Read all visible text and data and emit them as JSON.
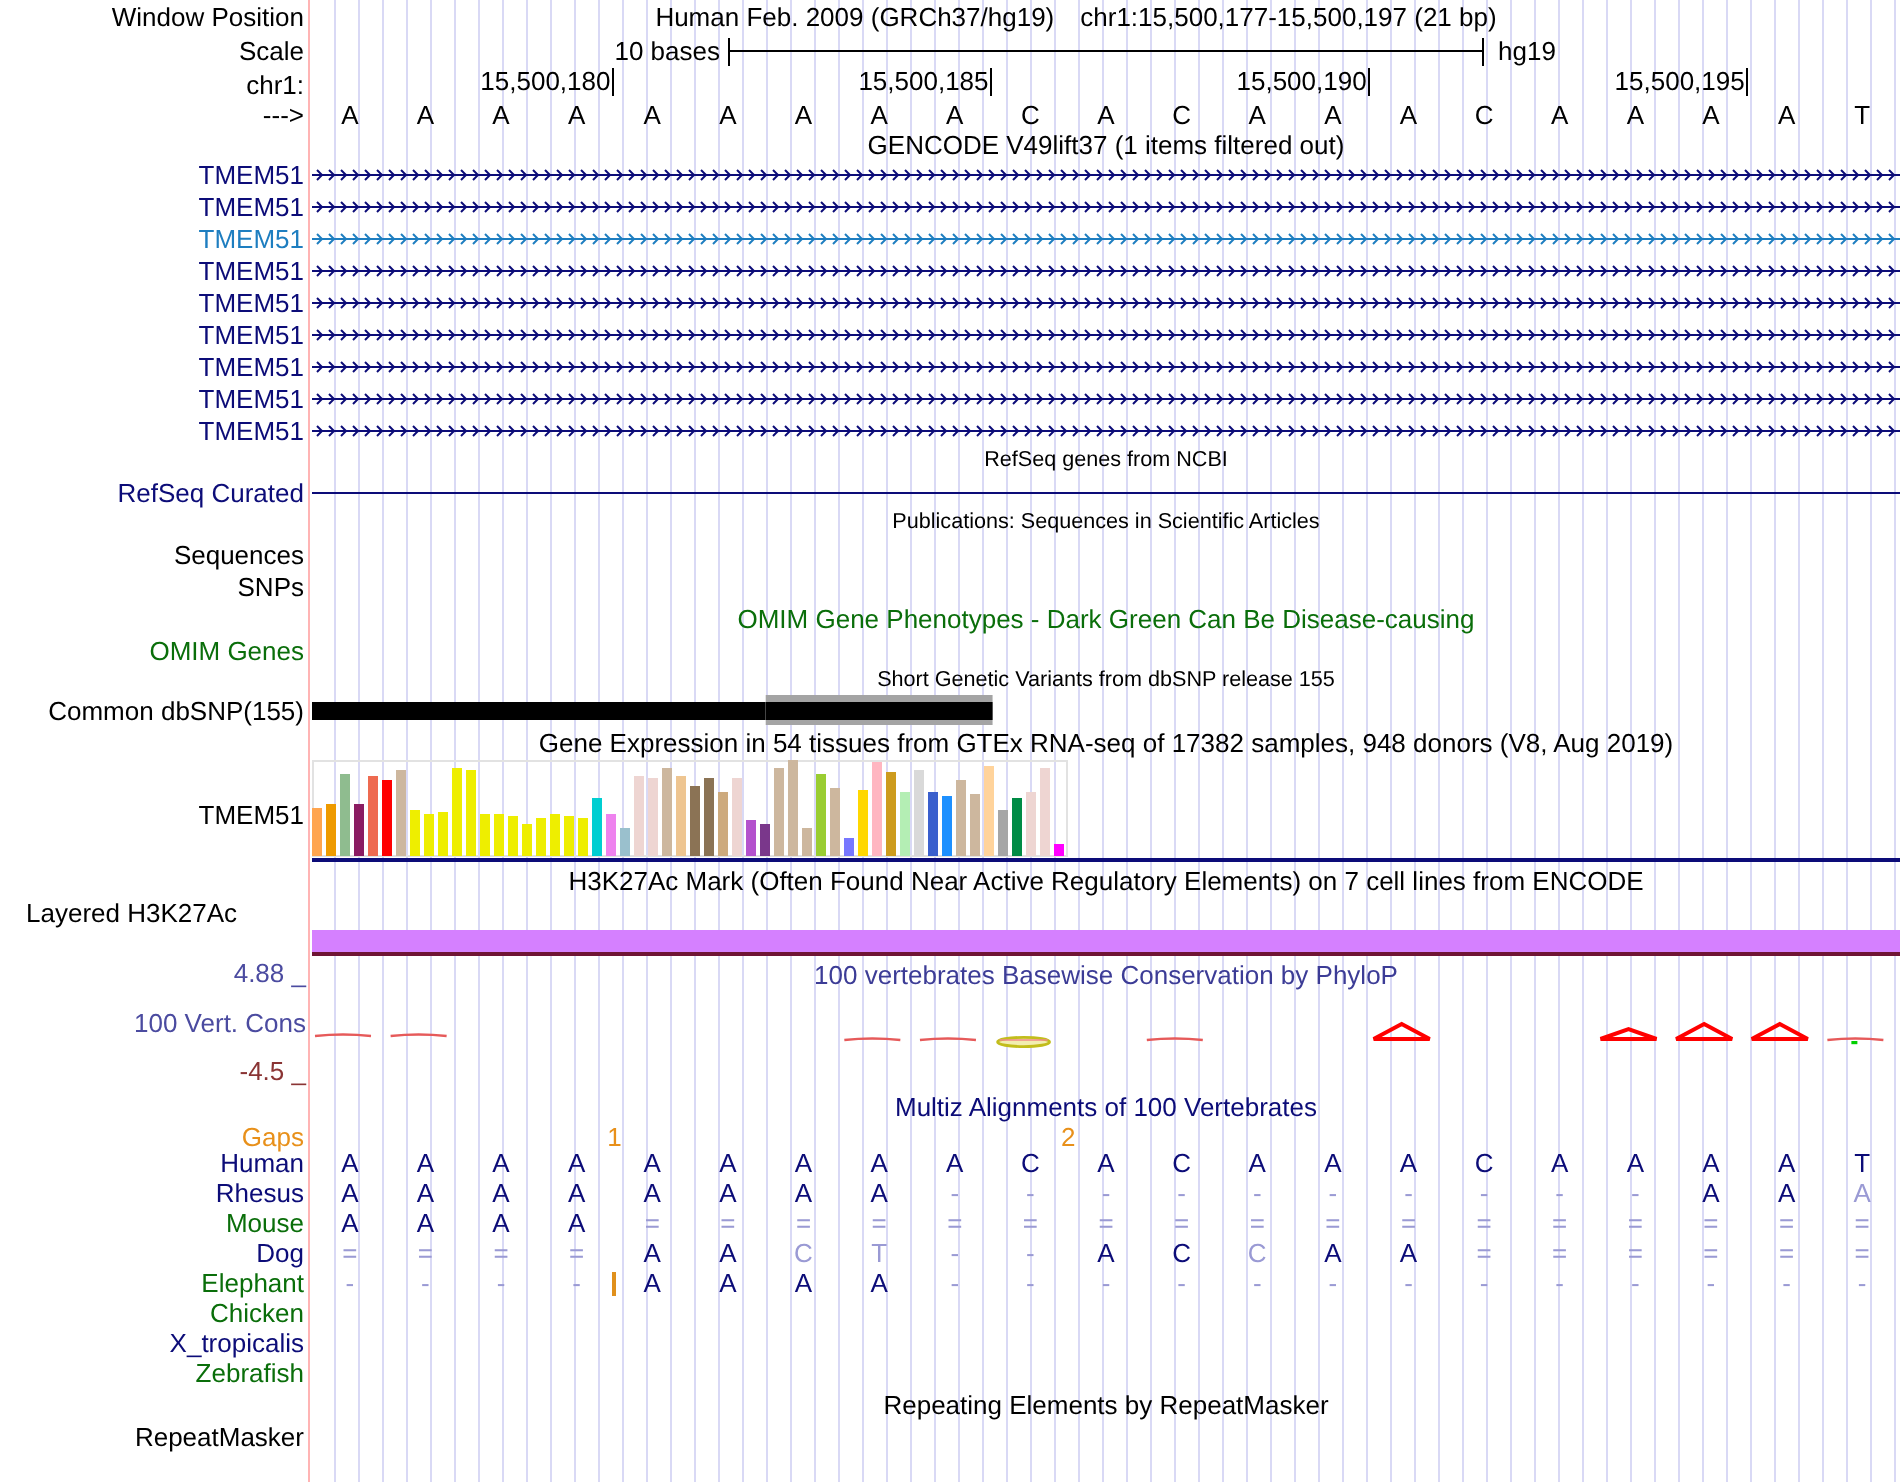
{
  "window_position": {
    "label": "Window Position",
    "assembly": "Human Feb. 2009 (GRCh37/hg19)",
    "position": "chr1:15,500,177-15,500,197 (21 bp)"
  },
  "scale": {
    "label": "Scale",
    "span": "10 bases",
    "assembly": "hg19"
  },
  "ruler": {
    "label": "chr1:",
    "ticks": [
      "15,500,180",
      "15,500,185",
      "15,500,190",
      "15,500,195"
    ]
  },
  "sequence": {
    "label": "--->",
    "bases": [
      {
        "base": "A"
      },
      {
        "base": "A"
      },
      {
        "base": "A"
      },
      {
        "base": "A",
        "gap_after": "1"
      },
      {
        "base": "A"
      },
      {
        "base": "A"
      },
      {
        "base": "A"
      },
      {
        "base": "A"
      },
      {
        "base": "A"
      },
      {
        "base": "C",
        "gap_after": "2"
      },
      {
        "base": "A"
      },
      {
        "base": "C"
      },
      {
        "base": "A"
      },
      {
        "base": "A"
      },
      {
        "base": "A"
      },
      {
        "base": "C"
      },
      {
        "base": "A"
      },
      {
        "base": "A"
      },
      {
        "base": "A"
      },
      {
        "base": "A"
      },
      {
        "base": "T"
      }
    ]
  },
  "gencode": {
    "title": "GENCODE V49lift37 (1 items filtered out)",
    "transcripts": [
      {
        "name": "TMEM51",
        "color": "#0c0c78"
      },
      {
        "name": "TMEM51",
        "color": "#0c0c78"
      },
      {
        "name": "TMEM51",
        "color": "#1e7ec0"
      },
      {
        "name": "TMEM51",
        "color": "#0c0c78"
      },
      {
        "name": "TMEM51",
        "color": "#0c0c78"
      },
      {
        "name": "TMEM51",
        "color": "#0c0c78"
      },
      {
        "name": "TMEM51",
        "color": "#0c0c78"
      },
      {
        "name": "TMEM51",
        "color": "#0c0c78"
      },
      {
        "name": "TMEM51",
        "color": "#0c0c78"
      }
    ]
  },
  "refseq": {
    "title": "RefSeq genes from NCBI",
    "label": "RefSeq Curated"
  },
  "publications": {
    "title": "Publications: Sequences in Scientific Articles",
    "labels": [
      "Sequences",
      "SNPs"
    ]
  },
  "omim": {
    "title": "OMIM Gene Phenotypes - Dark Green Can Be Disease-causing",
    "label": "OMIM Genes"
  },
  "dbsnp": {
    "title": "Short Genetic Variants from dbSNP release 155",
    "label": "Common dbSNP(155)"
  },
  "gtex": {
    "title": "Gene Expression in 54 tissues from GTEx RNA-seq of 17382 samples, 948 donors (V8, Aug 2019)",
    "label": "TMEM51"
  },
  "h3k27ac": {
    "title": "H3K27Ac Mark (Often Found Near Active Regulatory Elements) on 7 cell lines from ENCODE",
    "label": "Layered H3K27Ac"
  },
  "conservation": {
    "axis_max": "4.88 _",
    "title": "100 vertebrates Basewise Conservation by PhyloP",
    "label": "100 Vert. Cons",
    "axis_min": "-4.5 _"
  },
  "multiz": {
    "title": "Multiz Alignments of 100 Vertebrates",
    "gaps_label": "Gaps",
    "species": [
      {
        "name": "Human",
        "color": "#0c0c78",
        "bases": [
          {
            "base": "A",
            "dimmed": false
          },
          {
            "base": "A",
            "dimmed": false
          },
          {
            "base": "A",
            "dimmed": false
          },
          {
            "base": "A",
            "dimmed": false
          },
          {
            "base": "A",
            "dimmed": false
          },
          {
            "base": "A",
            "dimmed": false
          },
          {
            "base": "A",
            "dimmed": false
          },
          {
            "base": "A",
            "dimmed": false
          },
          {
            "base": "A",
            "dimmed": false
          },
          {
            "base": "C",
            "dimmed": false
          },
          {
            "base": "A",
            "dimmed": false
          },
          {
            "base": "C",
            "dimmed": false
          },
          {
            "base": "A",
            "dimmed": false
          },
          {
            "base": "A",
            "dimmed": false
          },
          {
            "base": "A",
            "dimmed": false
          },
          {
            "base": "C",
            "dimmed": false
          },
          {
            "base": "A",
            "dimmed": false
          },
          {
            "base": "A",
            "dimmed": false
          },
          {
            "base": "A",
            "dimmed": false
          },
          {
            "base": "A",
            "dimmed": false
          },
          {
            "base": "T",
            "dimmed": false
          }
        ]
      },
      {
        "name": "Rhesus",
        "color": "#0c0c78",
        "bases": [
          {
            "base": "A",
            "dimmed": false
          },
          {
            "base": "A",
            "dimmed": false
          },
          {
            "base": "A",
            "dimmed": false
          },
          {
            "base": "A",
            "dimmed": false
          },
          {
            "base": "A",
            "dimmed": false
          },
          {
            "base": "A",
            "dimmed": false
          },
          {
            "base": "A",
            "dimmed": false
          },
          {
            "base": "A",
            "dimmed": false
          },
          {
            "base": "-",
            "dimmed": true
          },
          {
            "base": "-",
            "dimmed": true
          },
          {
            "base": "-",
            "dimmed": true
          },
          {
            "base": "-",
            "dimmed": true
          },
          {
            "base": "-",
            "dimmed": true
          },
          {
            "base": "-",
            "dimmed": true
          },
          {
            "base": "-",
            "dimmed": true
          },
          {
            "base": "-",
            "dimmed": true
          },
          {
            "base": "-",
            "dimmed": true
          },
          {
            "base": "-",
            "dimmed": true
          },
          {
            "base": "A",
            "dimmed": false
          },
          {
            "base": "A",
            "dimmed": false
          },
          {
            "base": "A",
            "dimmed": true
          }
        ]
      },
      {
        "name": "Mouse",
        "color": "#0a6e0a",
        "bases": [
          {
            "base": "A",
            "dimmed": false
          },
          {
            "base": "A",
            "dimmed": false
          },
          {
            "base": "A",
            "dimmed": false
          },
          {
            "base": "A",
            "dimmed": false
          },
          {
            "base": "=",
            "dimmed": true
          },
          {
            "base": "=",
            "dimmed": true
          },
          {
            "base": "=",
            "dimmed": true
          },
          {
            "base": "=",
            "dimmed": true
          },
          {
            "base": "=",
            "dimmed": true
          },
          {
            "base": "=",
            "dimmed": true
          },
          {
            "base": "=",
            "dimmed": true
          },
          {
            "base": "=",
            "dimmed": true
          },
          {
            "base": "=",
            "dimmed": true
          },
          {
            "base": "=",
            "dimmed": true
          },
          {
            "base": "=",
            "dimmed": true
          },
          {
            "base": "=",
            "dimmed": true
          },
          {
            "base": "=",
            "dimmed": true
          },
          {
            "base": "=",
            "dimmed": true
          },
          {
            "base": "=",
            "dimmed": true
          },
          {
            "base": "=",
            "dimmed": true
          },
          {
            "base": "=",
            "dimmed": true
          }
        ]
      },
      {
        "name": "Dog",
        "color": "#0c0c78",
        "bases": [
          {
            "base": "=",
            "dimmed": true
          },
          {
            "base": "=",
            "dimmed": true
          },
          {
            "base": "=",
            "dimmed": true
          },
          {
            "base": "=",
            "dimmed": true
          },
          {
            "base": "A",
            "dimmed": false
          },
          {
            "base": "A",
            "dimmed": false
          },
          {
            "base": "C",
            "dimmed": true
          },
          {
            "base": "T",
            "dimmed": true
          },
          {
            "base": "-",
            "dimmed": true
          },
          {
            "base": "-",
            "dimmed": true
          },
          {
            "base": "A",
            "dimmed": false
          },
          {
            "base": "C",
            "dimmed": false
          },
          {
            "base": "C",
            "dimmed": true
          },
          {
            "base": "A",
            "dimmed": false
          },
          {
            "base": "A",
            "dimmed": false
          },
          {
            "base": "=",
            "dimmed": true
          },
          {
            "base": "=",
            "dimmed": true
          },
          {
            "base": "=",
            "dimmed": true
          },
          {
            "base": "=",
            "dimmed": true
          },
          {
            "base": "=",
            "dimmed": true
          },
          {
            "base": "=",
            "dimmed": true
          }
        ]
      },
      {
        "name": "Elephant",
        "color": "#0a6e0a",
        "bases": [
          {
            "base": "-",
            "dimmed": true,
            "insert_after": false
          },
          {
            "base": "-",
            "dimmed": true,
            "insert_after": false
          },
          {
            "base": "-",
            "dimmed": true,
            "insert_after": false
          },
          {
            "base": "-",
            "dimmed": true,
            "insert_after": true
          },
          {
            "base": "A",
            "dimmed": false,
            "insert_after": false
          },
          {
            "base": "A",
            "dimmed": false,
            "insert_after": false
          },
          {
            "base": "A",
            "dimmed": false,
            "insert_after": false
          },
          {
            "base": "A",
            "dimmed": false,
            "insert_after": false
          },
          {
            "base": "-",
            "dimmed": true,
            "insert_after": false
          },
          {
            "base": "-",
            "dimmed": true,
            "insert_after": false
          },
          {
            "base": "-",
            "dimmed": true,
            "insert_after": false
          },
          {
            "base": "-",
            "dimmed": true,
            "insert_after": false
          },
          {
            "base": "-",
            "dimmed": true,
            "insert_after": false
          },
          {
            "base": "-",
            "dimmed": true,
            "insert_after": false
          },
          {
            "base": "-",
            "dimmed": true,
            "insert_after": false
          },
          {
            "base": "-",
            "dimmed": true,
            "insert_after": false
          },
          {
            "base": "-",
            "dimmed": true,
            "insert_after": false
          },
          {
            "base": "-",
            "dimmed": true,
            "insert_after": false
          },
          {
            "base": "-",
            "dimmed": true,
            "insert_after": false
          },
          {
            "base": "-",
            "dimmed": true,
            "insert_after": false
          },
          {
            "base": "-",
            "dimmed": true,
            "insert_after": false
          }
        ]
      },
      {
        "name": "Chicken",
        "color": "#0a6e0a"
      },
      {
        "name": "X_tropicalis",
        "color": "#0c0c78"
      },
      {
        "name": "Zebrafish",
        "color": "#0a6e0a"
      }
    ]
  },
  "repeatmasker": {
    "title": "Repeating Elements by RepeatMasker",
    "label": "RepeatMasker"
  }
}
